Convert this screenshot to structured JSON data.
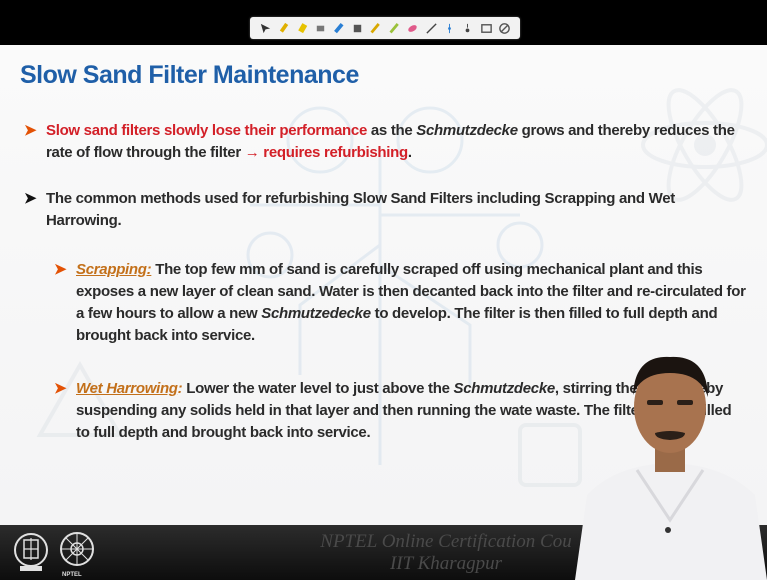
{
  "slide": {
    "title": "Slow Sand Filter Maintenance",
    "bullets": [
      {
        "lead_red": "Slow sand filters slowly lose their performance",
        "text_1": " as the ",
        "em_1": "Schmutzdecke",
        "text_2": " grows and thereby reduces the rate of flow through the filter ",
        "arrow_glyph": "→",
        "tail_red": " requires refurbishing",
        "tail_end": "."
      },
      {
        "text": "The common methods used for refurbishing Slow Sand Filters including Scrapping and Wet Harrowing."
      },
      {
        "term": "Scrapping:",
        "text_1": " The top few mm of sand is carefully scraped off using mechanical plant and this exposes a new layer of clean sand. Water is then decanted back into the filter and re-circulated for a few hours to allow a new ",
        "em_1": "Schmutzedecke",
        "text_2": " to develop. The filter is then filled to full depth and brought back into service."
      },
      {
        "term": "Wet Harrowing",
        "colon": ":",
        "text_1": " Lower the water level to just above the ",
        "em_1": "Schmutzdecke",
        "text_2": ", stirring the  and thereby suspending any solids held in that layer and then running the wate waste. The filter is then filled to full depth and brought back into service."
      }
    ],
    "bullet_glyph": "➤"
  },
  "footer": {
    "line_1": "NPTEL Online Certification Cou",
    "line_2": "IIT Kharagpur",
    "logo_caption": "NPTEL"
  },
  "toolbar": {
    "tools": [
      "pointer-icon",
      "pen-icon",
      "highlighter-icon",
      "eraser-icon",
      "marker-icon",
      "text-icon",
      "pencil-icon",
      "brush-icon",
      "color-icon",
      "shape-icon",
      "line-icon",
      "laser-icon",
      "screen-icon",
      "clear-icon"
    ]
  },
  "colors": {
    "title": "#1f5fa8",
    "bullet_arrow": "#e35205",
    "highlight_red": "#d32028",
    "term": "#c3701a",
    "body_text": "#2b2b2b"
  }
}
